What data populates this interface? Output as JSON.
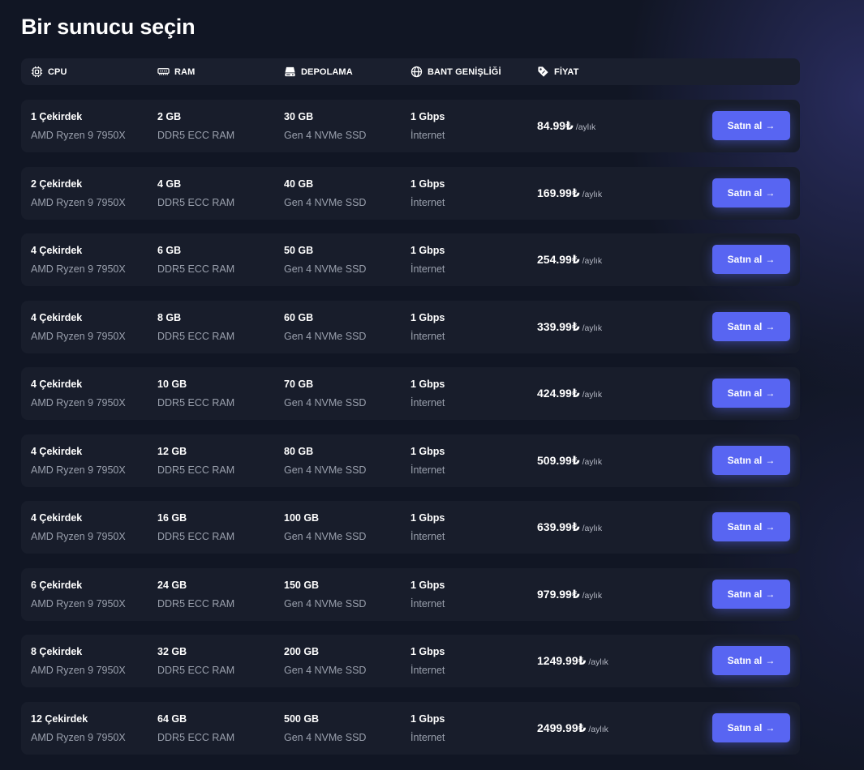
{
  "page": {
    "title": "Bir sunucu seçin"
  },
  "header": {
    "cpu": "CPU",
    "ram": "RAM",
    "storage": "DEPOLAMA",
    "bandwidth": "BANT GENİŞLİĞİ",
    "price": "FİYAT"
  },
  "icons": {
    "cpu": "cpu-icon",
    "ram": "memory-icon",
    "storage": "hard-drive-icon",
    "bandwidth": "globe-icon",
    "price": "price-tag-icon",
    "button": "arrow-right-icon"
  },
  "colors": {
    "background": "#111624",
    "row": "#181d2b",
    "accent": "#5865f2"
  },
  "buy_label": "Satın al",
  "buy_arrow": "→",
  "period_label": "/aylık",
  "servers": [
    {
      "cpu": "1 Çekirdek",
      "cpu_model": "AMD Ryzen 9 7950X",
      "ram": "2 GB",
      "ram_type": "DDR5 ECC RAM",
      "storage": "30 GB",
      "storage_type": "Gen 4 NVMe SSD",
      "bandwidth": "1 Gbps",
      "bandwidth_type": "İnternet",
      "price": "84.99₺"
    },
    {
      "cpu": "2 Çekirdek",
      "cpu_model": "AMD Ryzen 9 7950X",
      "ram": "4 GB",
      "ram_type": "DDR5 ECC RAM",
      "storage": "40 GB",
      "storage_type": "Gen 4 NVMe SSD",
      "bandwidth": "1 Gbps",
      "bandwidth_type": "İnternet",
      "price": "169.99₺"
    },
    {
      "cpu": "4 Çekirdek",
      "cpu_model": "AMD Ryzen 9 7950X",
      "ram": "6 GB",
      "ram_type": "DDR5 ECC RAM",
      "storage": "50 GB",
      "storage_type": "Gen 4 NVMe SSD",
      "bandwidth": "1 Gbps",
      "bandwidth_type": "İnternet",
      "price": "254.99₺"
    },
    {
      "cpu": "4 Çekirdek",
      "cpu_model": "AMD Ryzen 9 7950X",
      "ram": "8 GB",
      "ram_type": "DDR5 ECC RAM",
      "storage": "60 GB",
      "storage_type": "Gen 4 NVMe SSD",
      "bandwidth": "1 Gbps",
      "bandwidth_type": "İnternet",
      "price": "339.99₺"
    },
    {
      "cpu": "4 Çekirdek",
      "cpu_model": "AMD Ryzen 9 7950X",
      "ram": "10 GB",
      "ram_type": "DDR5 ECC RAM",
      "storage": "70 GB",
      "storage_type": "Gen 4 NVMe SSD",
      "bandwidth": "1 Gbps",
      "bandwidth_type": "İnternet",
      "price": "424.99₺"
    },
    {
      "cpu": "4 Çekirdek",
      "cpu_model": "AMD Ryzen 9 7950X",
      "ram": "12 GB",
      "ram_type": "DDR5 ECC RAM",
      "storage": "80 GB",
      "storage_type": "Gen 4 NVMe SSD",
      "bandwidth": "1 Gbps",
      "bandwidth_type": "İnternet",
      "price": "509.99₺"
    },
    {
      "cpu": "4 Çekirdek",
      "cpu_model": "AMD Ryzen 9 7950X",
      "ram": "16 GB",
      "ram_type": "DDR5 ECC RAM",
      "storage": "100 GB",
      "storage_type": "Gen 4 NVMe SSD",
      "bandwidth": "1 Gbps",
      "bandwidth_type": "İnternet",
      "price": "639.99₺"
    },
    {
      "cpu": "6 Çekirdek",
      "cpu_model": "AMD Ryzen 9 7950X",
      "ram": "24 GB",
      "ram_type": "DDR5 ECC RAM",
      "storage": "150 GB",
      "storage_type": "Gen 4 NVMe SSD",
      "bandwidth": "1 Gbps",
      "bandwidth_type": "İnternet",
      "price": "979.99₺"
    },
    {
      "cpu": "8 Çekirdek",
      "cpu_model": "AMD Ryzen 9 7950X",
      "ram": "32 GB",
      "ram_type": "DDR5 ECC RAM",
      "storage": "200 GB",
      "storage_type": "Gen 4 NVMe SSD",
      "bandwidth": "1 Gbps",
      "bandwidth_type": "İnternet",
      "price": "1249.99₺"
    },
    {
      "cpu": "12 Çekirdek",
      "cpu_model": "AMD Ryzen 9 7950X",
      "ram": "64 GB",
      "ram_type": "DDR5 ECC RAM",
      "storage": "500 GB",
      "storage_type": "Gen 4 NVMe SSD",
      "bandwidth": "1 Gbps",
      "bandwidth_type": "İnternet",
      "price": "2499.99₺"
    }
  ]
}
